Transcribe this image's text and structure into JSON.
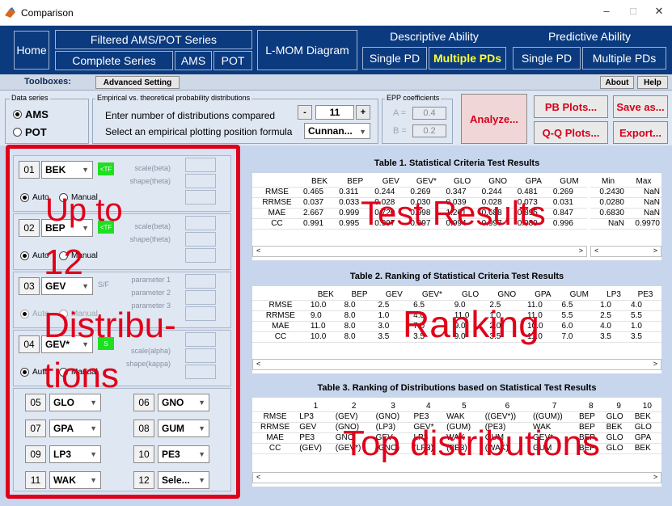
{
  "window": {
    "title": "Comparison",
    "controls": [
      "–",
      "□",
      "✕"
    ]
  },
  "nav": {
    "home": "Home",
    "filtered": "Filtered AMS/POT Series",
    "complete": "Complete Series",
    "ams": "AMS",
    "pot": "POT",
    "lmom": "L-MOM Diagram",
    "descriptive": "Descriptive Ability",
    "predictive": "Predictive Ability",
    "desc_single": "Single PD",
    "desc_multiple": "Multiple PDs",
    "pred_single": "Single PD",
    "pred_multiple": "Multiple PDs"
  },
  "toolbar": {
    "label": "Toolboxes:",
    "advanced": "Advanced Setting",
    "about": "About",
    "help": "Help"
  },
  "controls": {
    "data_series_label": "Data series",
    "ams": "AMS",
    "pot": "POT",
    "empirical_label": "Empirical vs. theoretical probability distributions",
    "enter_text": "Enter number of distributions compared",
    "minus": "-",
    "count": "11",
    "plus": "+",
    "select_text": "Select an empirical plotting position formula",
    "formula": "Cunnan...",
    "epp_label": "EPP coefficients",
    "a_label": "A =",
    "a_value": "0.4",
    "b_label": "B =",
    "b_value": "0.2",
    "analyze": "Analyze...",
    "pb_plots": "PB Plots...",
    "qq_plots": "Q-Q Plots...",
    "save_as": "Save as...",
    "export": "Export..."
  },
  "distributions": {
    "d1": {
      "num": "01",
      "name": "BEK",
      "tf": "<TF",
      "p1": "scale(beta)",
      "p2": "shape(theta)"
    },
    "d2": {
      "num": "02",
      "name": "BEP",
      "tf": "<TF",
      "p1": "scale(beta)",
      "p2": "shape(theta)"
    },
    "d3": {
      "num": "03",
      "name": "GEV",
      "tf": "S/F",
      "p1": "parameter 1",
      "p2": "parameter 2",
      "p3": "parameter 3"
    },
    "d4": {
      "num": "04",
      "name": "GEV*",
      "tf": "S",
      "p1": "scale(alpha)",
      "p2": "shape(kappa)"
    },
    "auto": "Auto",
    "manual": "Manual",
    "grid": [
      {
        "num": "05",
        "name": "GLO"
      },
      {
        "num": "06",
        "name": "GNO"
      },
      {
        "num": "07",
        "name": "GPA"
      },
      {
        "num": "08",
        "name": "GUM"
      },
      {
        "num": "09",
        "name": "LP3"
      },
      {
        "num": "10",
        "name": "PE3"
      },
      {
        "num": "11",
        "name": "WAK"
      },
      {
        "num": "12",
        "name": "Sele..."
      }
    ]
  },
  "table1": {
    "title": "Table 1. Statistical Criteria Test Results",
    "cols": [
      "BEK",
      "BEP",
      "GEV",
      "GEV*",
      "GLO",
      "GNO",
      "GPA",
      "GUM"
    ],
    "rows": [
      {
        "label": "RMSE",
        "vals": [
          "0.465",
          "0.311",
          "0.244",
          "0.269",
          "0.347",
          "0.244",
          "0.481",
          "0.269"
        ]
      },
      {
        "label": "RRMSE",
        "vals": [
          "0.037",
          "0.033",
          "0.028",
          "0.030",
          "0.039",
          "0.028",
          "0.073",
          "0.031"
        ]
      },
      {
        "label": "MAE",
        "vals": [
          "2.667",
          "0.999",
          "0.720",
          "0.998",
          "1.261",
          "0.688",
          "0.895",
          "0.847"
        ]
      },
      {
        "label": "CC",
        "vals": [
          "0.991",
          "0.995",
          "0.997",
          "0.997",
          "0.994",
          "0.997",
          "0.989",
          "0.996"
        ]
      }
    ],
    "side_cols": [
      "Min",
      "Max"
    ],
    "side_rows": [
      [
        "0.2430",
        "NaN"
      ],
      [
        "0.0280",
        "NaN"
      ],
      [
        "0.6830",
        "NaN"
      ],
      [
        "NaN",
        "0.9970"
      ]
    ]
  },
  "table2": {
    "title": "Table 2. Ranking of Statistical Criteria Test Results",
    "cols": [
      "BEK",
      "BEP",
      "GEV",
      "GEV*",
      "GLO",
      "GNO",
      "GPA",
      "GUM",
      "LP3",
      "PE3"
    ],
    "rows": [
      {
        "label": "RMSE",
        "vals": [
          "10.0",
          "8.0",
          "2.5",
          "6.5",
          "9.0",
          "2.5",
          "11.0",
          "6.5",
          "1.0",
          "4.0"
        ]
      },
      {
        "label": "RRMSE",
        "vals": [
          "9.0",
          "8.0",
          "1.0",
          "4.0",
          "11.0",
          "1.0",
          "11.0",
          "5.5",
          "2.5",
          "5.5"
        ]
      },
      {
        "label": "MAE",
        "vals": [
          "11.0",
          "8.0",
          "3.0",
          "7.0",
          "9.0",
          "2.0",
          "10.0",
          "6.0",
          "4.0",
          "1.0"
        ]
      },
      {
        "label": "CC",
        "vals": [
          "10.0",
          "8.0",
          "3.5",
          "3.5",
          "9.0",
          "3.5",
          "11.0",
          "7.0",
          "3.5",
          "3.5"
        ]
      }
    ]
  },
  "table3": {
    "title": "Table 3. Ranking of Distributions based on Statistical Test Results",
    "cols": [
      "1",
      "2",
      "3",
      "4",
      "5",
      "6",
      "7",
      "8",
      "9",
      "10"
    ],
    "rows": [
      {
        "label": "RMSE",
        "vals": [
          "LP3",
          "(GEV)",
          "(GNO)",
          "PE3",
          "WAK",
          "((GEV*))",
          "((GUM))",
          "BEP",
          "GLO",
          "BEK"
        ]
      },
      {
        "label": "RRMSE",
        "vals": [
          "GEV",
          "(GNO)",
          "(LP3)",
          "GEV*",
          "(GUM)",
          "(PE3)",
          "WAK",
          "BEP",
          "BEK",
          "GLO"
        ]
      },
      {
        "label": "MAE",
        "vals": [
          "PE3",
          "GNO",
          "GEV",
          "LP3",
          "WAK",
          "GUM",
          "GEV*",
          "BEP",
          "GLO",
          "GPA"
        ]
      },
      {
        "label": "CC",
        "vals": [
          "(GEV)",
          "(GEV*)",
          "(GNO)",
          "(LP3)",
          "(PE3)",
          "(WAK)",
          "GUM",
          "BEP",
          "GLO",
          "BEK"
        ]
      }
    ]
  },
  "annotations": {
    "up_to": "Up to",
    "twelve": "12",
    "distribu": "Distribu-",
    "tions": "tions",
    "test_results": "Test Results",
    "ranking": "Ranking",
    "top_distributions": "Top distributions"
  },
  "colors": {
    "nav_bg": "#0b3a7e",
    "highlight_text": "#ffff33",
    "accent_red": "#e0001a",
    "panel_bg": "#c7d6ec"
  }
}
